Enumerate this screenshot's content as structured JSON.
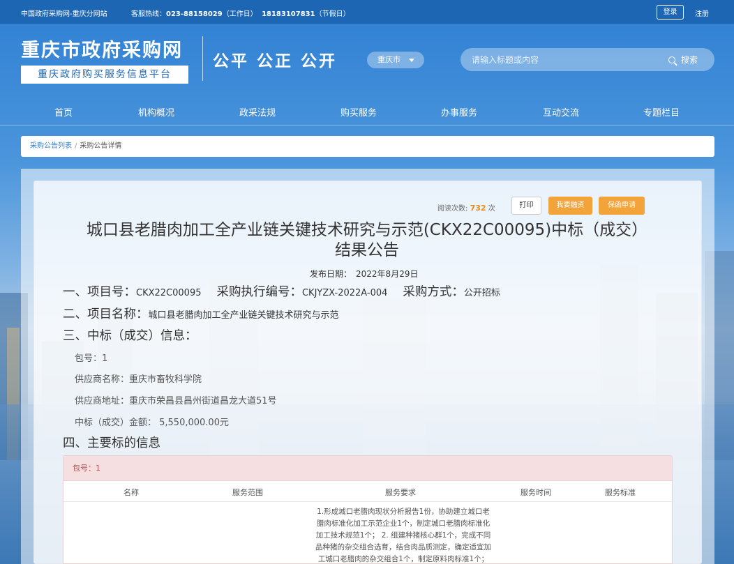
{
  "topbar": {
    "site": "中国政府采购网-重庆分网站",
    "hotline_label": "客服热线：",
    "hotline_work": "023-88158029",
    "hotline_work_note": "（工作日）",
    "hotline_holiday": "18183107831",
    "hotline_holiday_note": "（节假日）",
    "login": "登录",
    "register": "注册"
  },
  "header": {
    "title": "重庆市政府采购网",
    "subtitle": "重庆政府购买服务信息平台",
    "slogan": "公平 公正 公开",
    "city": "重庆市",
    "search_placeholder": "请输入标题或内容",
    "search_button": "搜索"
  },
  "nav": [
    "首页",
    "机构概况",
    "政采法规",
    "购买服务",
    "办事服务",
    "互动交流",
    "专题栏目"
  ],
  "breadcrumb": {
    "list": "采购公告列表",
    "sep": "/",
    "current": "采购公告详情"
  },
  "actions": {
    "reads_label": "阅读次数:",
    "reads_value": "732",
    "reads_unit": "次",
    "print": "打印",
    "finance": "我要融资",
    "insurance": "保函申请"
  },
  "doc": {
    "title_line1": "城口县老腊肉加工全产业链关键技术研究与示范(CKX22C00095)中标（成交）",
    "title_line2": "结果公告",
    "publish_label": "发布日期：",
    "publish_date": "2022年8月29日",
    "s1_project_label": "一、项目号：",
    "s1_project_value": "CKX22C00095",
    "s1_exec_label": "采购执行编号：",
    "s1_exec_value": "CKJYZX-2022A-004",
    "s1_method_label": "采购方式：",
    "s1_method_value": "公开招标",
    "s2_label": "二、项目名称：",
    "s2_value": "城口县老腊肉加工全产业链关键技术研究与示范",
    "s3_label": "三、中标（成交）信息：",
    "pkg_row": "包号：1",
    "supplier_name": "供应商名称：重庆市畜牧科学院",
    "supplier_addr": "供应商地址：重庆市荣昌县昌州街道昌龙大道51号",
    "amount": "中标（成交）金额： 5,550,000.00元",
    "s4_label": "四、主要标的信息"
  },
  "table": {
    "package": "包号：1",
    "headers": [
      "名称",
      "服务范围",
      "服务要求",
      "服务时间",
      "服务标准"
    ],
    "requirement_lines": [
      "1.形成城口老腊肉现状分析报告1份，协助建立城口老",
      "腊肉标准化加工示范企业1个，制定城口老腊肉标准化",
      "加工技术规范1个； 2. 组建种猪核心群1个，完成不同",
      "品种猪的杂交组合选育，结合肉品质测定，确定适宜加",
      "工城口老腊肉的杂交组合1个，制定原料肉标准1个；"
    ]
  }
}
